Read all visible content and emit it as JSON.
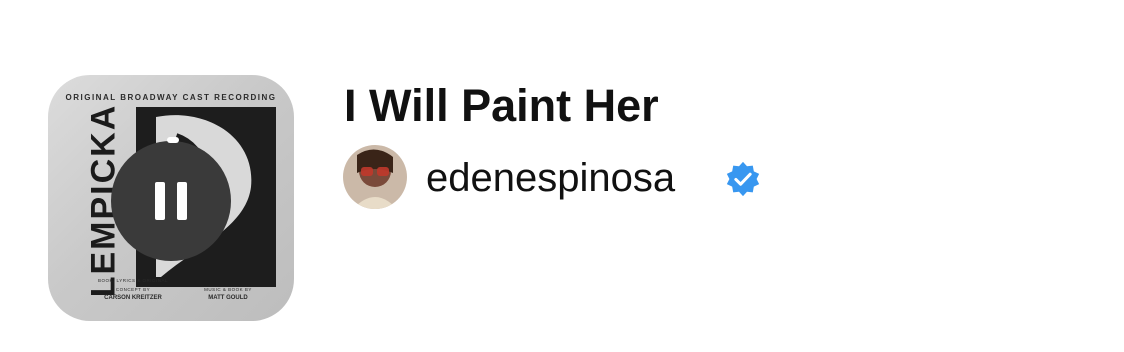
{
  "album_art": {
    "top_text": "ORIGINAL BROADWAY CAST RECORDING",
    "vertical_title": "LEMPICKA",
    "credit_left_small": "BOOK, LYRICS & ORIGINAL CONCEPT BY",
    "credit_left": "CARSON KREITZER",
    "credit_right_small": "MUSIC & BOOK BY",
    "credit_right": "MATT GOULD"
  },
  "player": {
    "state_icon": "pause-icon"
  },
  "song": {
    "title": "I Will Paint Her"
  },
  "artist": {
    "username": "edenespinosa",
    "verified_icon": "verified-badge-icon",
    "verified_color": "#3897f0"
  }
}
